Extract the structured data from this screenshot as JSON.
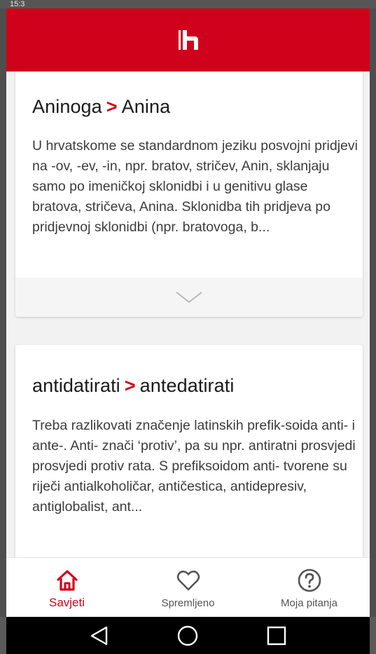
{
  "status_bar": {
    "text": "15:3"
  },
  "app": {
    "brand_color": "#d0021b",
    "logo_icon": "h-logo-icon"
  },
  "cards": [
    {
      "title_from": "Aninoga",
      "arrow": ">",
      "title_to": "Anina",
      "text": "U hrvatskome se standardnom jeziku posvojni pridjevi na -ov, -ev, -in, npr. bratov, stričev, Anin, sklanjaju samo po imeničkoj sklonidbi i u genitivu glase bratova, stričeva, Anina. Sklonidba tih pridjeva po pridjevnoj sklonidbi (npr. bratovoga, b...",
      "expand_icon": "chevron-down-icon"
    },
    {
      "title_from": "antidatirati",
      "arrow": ">",
      "title_to": "antedatirati",
      "text": "Treba razlikovati značenje latinskih prefik-soida anti- i ante-. Anti- znači ‘protiv’, pa su npr. antiratni prosvjedi prosvjedi protiv rata. S prefiksoidom anti- tvorene su riječi antialkoholičar, antičestica, antidepresiv, antiglobalist, ant..."
    }
  ],
  "bottom_nav": {
    "items": [
      {
        "label": "Savjeti",
        "icon": "home-icon",
        "active": true
      },
      {
        "label": "Spremljeno",
        "icon": "heart-icon",
        "active": false
      },
      {
        "label": "Moja pitanja",
        "icon": "question-icon",
        "active": false
      }
    ]
  },
  "system_nav": [
    "back-icon",
    "home-circle-icon",
    "recents-icon"
  ]
}
